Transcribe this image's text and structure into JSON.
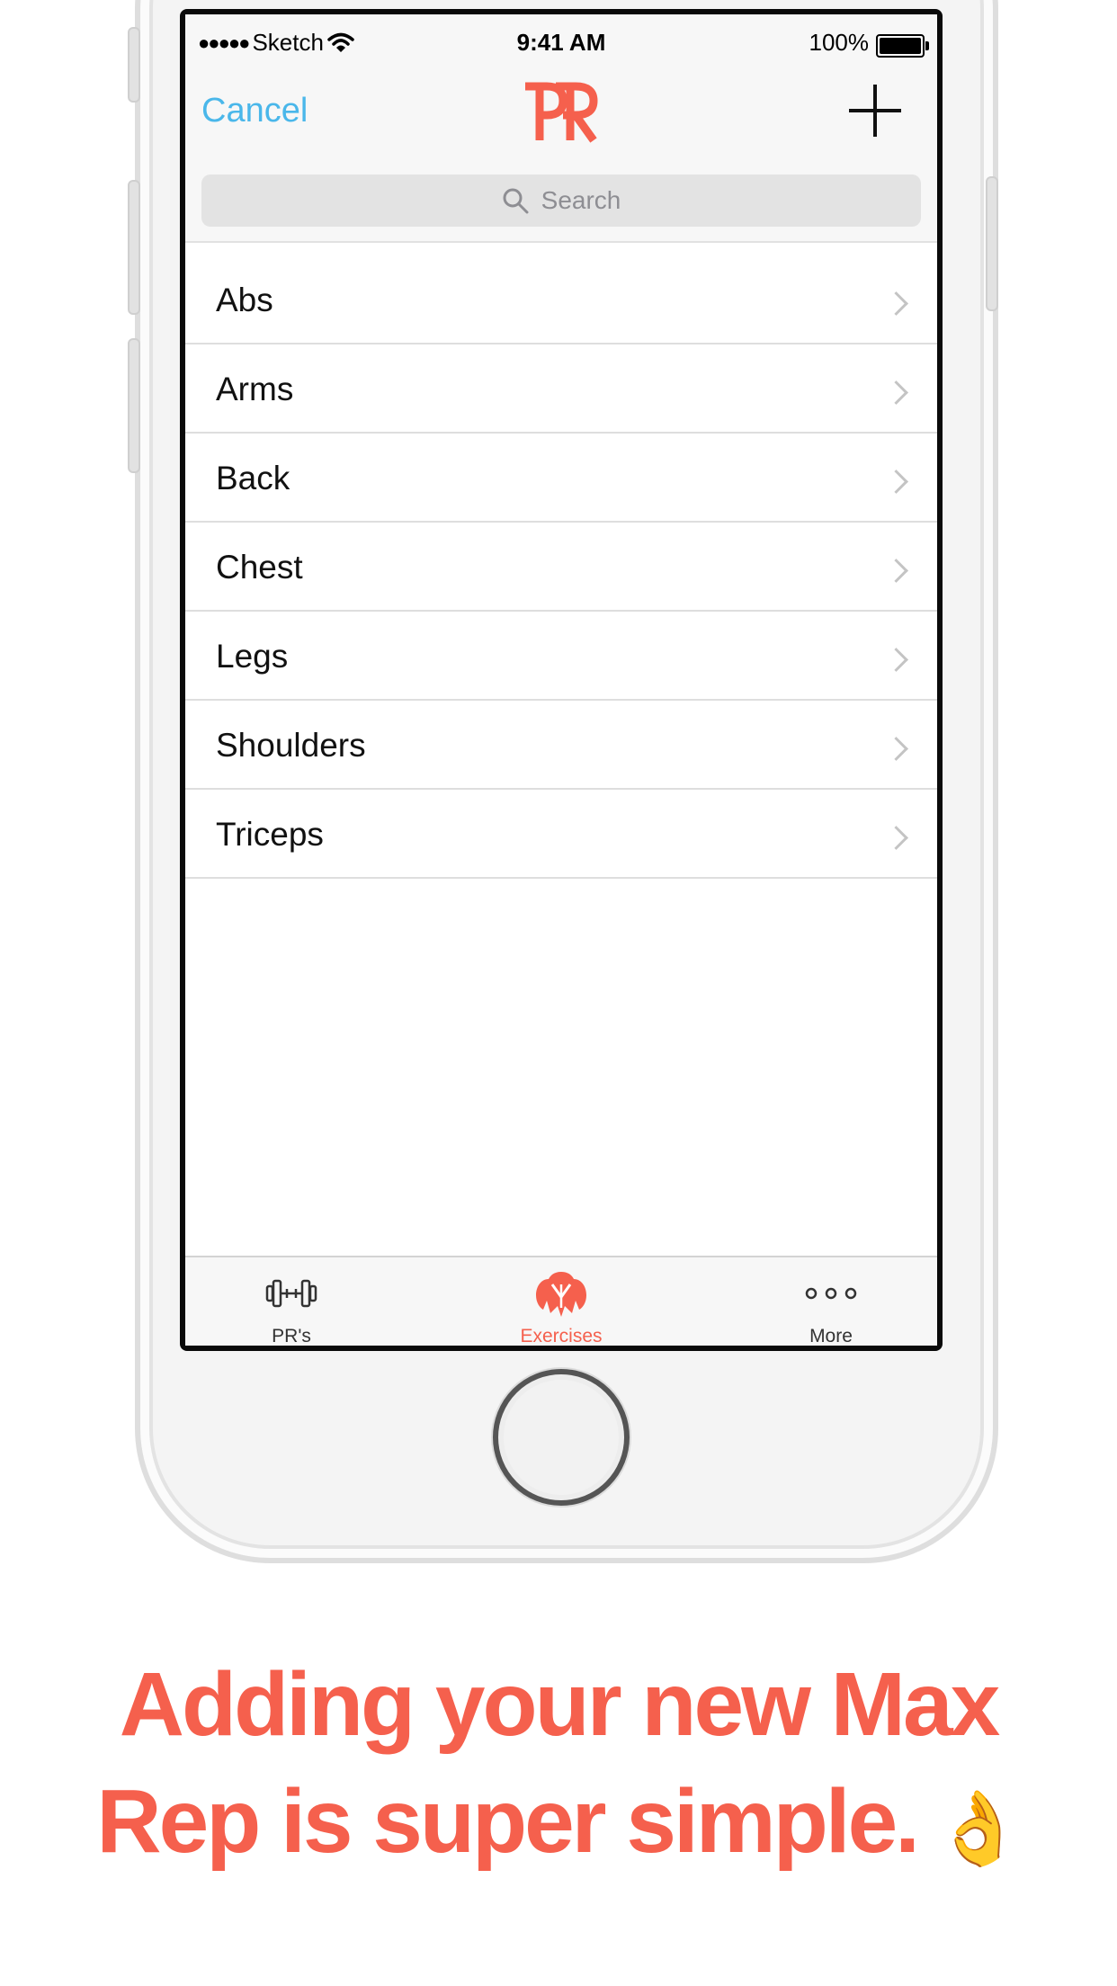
{
  "status_bar": {
    "carrier": "Sketch",
    "signal_dots": "●●●●●",
    "time": "9:41 AM",
    "battery": "100%",
    "battery_level": 1.0
  },
  "nav": {
    "cancel_label": "Cancel",
    "logo_text": "PR"
  },
  "search": {
    "placeholder": "Search"
  },
  "categories": [
    "Abs",
    "Arms",
    "Back",
    "Chest",
    "Legs",
    "Shoulders",
    "Triceps"
  ],
  "tabs": [
    {
      "label": "PR's",
      "icon": "dumbbell-icon",
      "active": false
    },
    {
      "label": "Exercises",
      "icon": "muscle-torso-icon",
      "active": true
    },
    {
      "label": "More",
      "icon": "more-dots-icon",
      "active": false
    }
  ],
  "headline": {
    "line1": "Adding your new Max",
    "line2": "Rep is super simple.",
    "emoji": "👌"
  },
  "colors": {
    "accent": "#f5604d",
    "link": "#4ab7ea"
  }
}
